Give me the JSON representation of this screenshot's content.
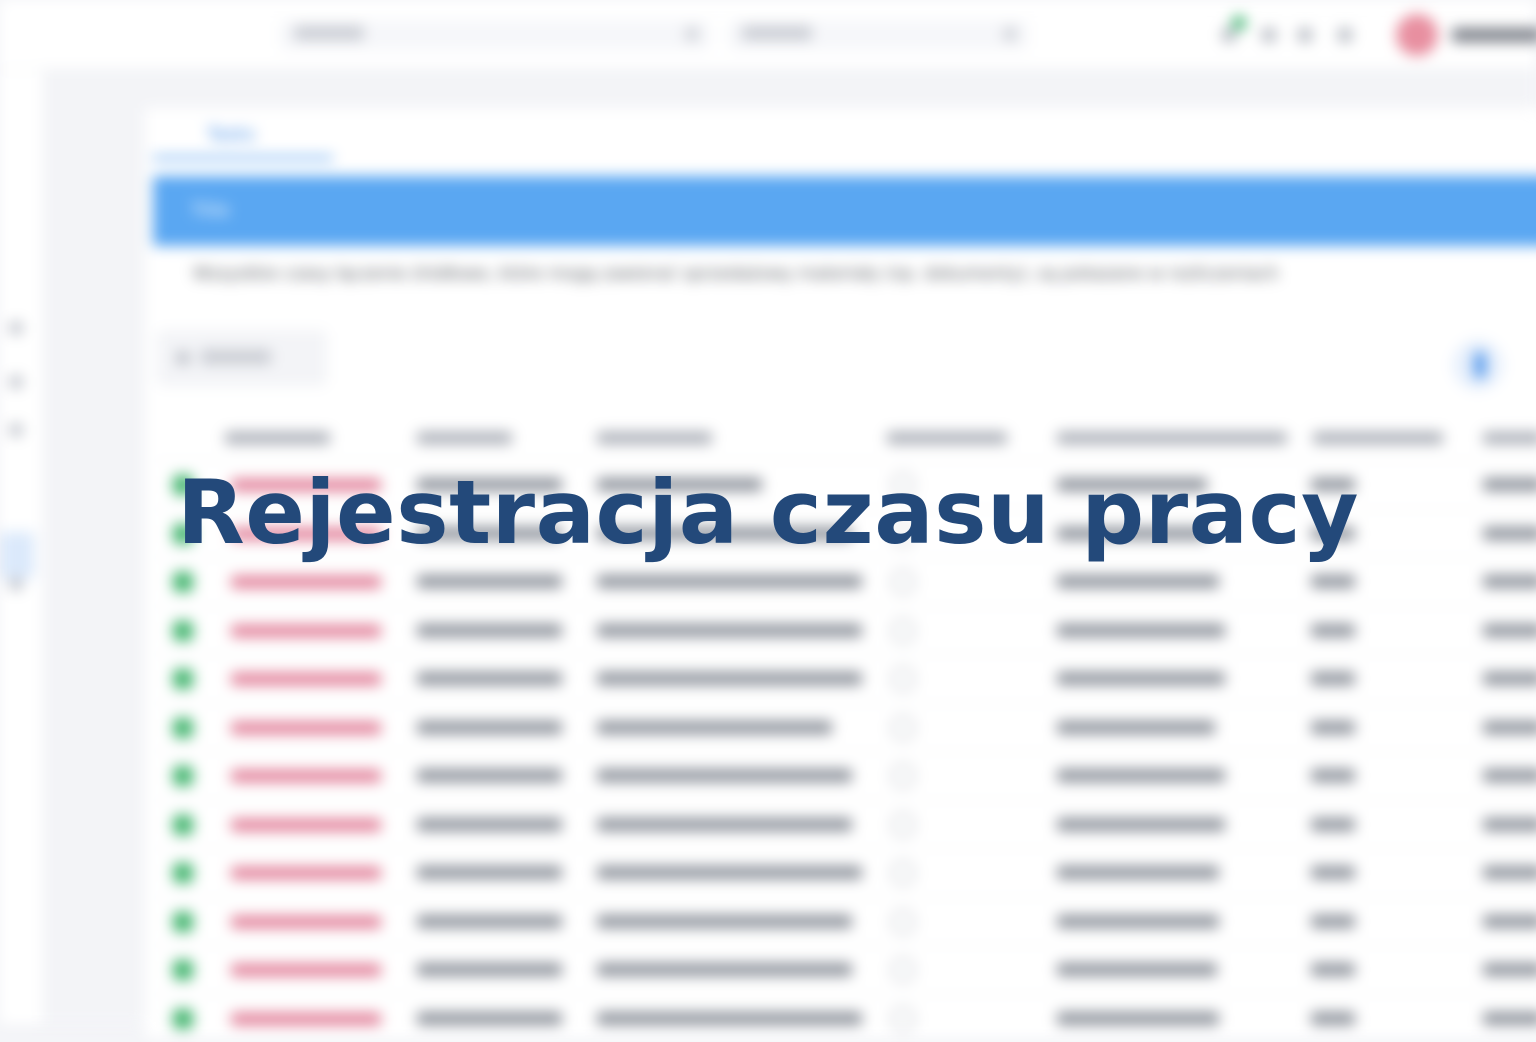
{
  "app": {
    "tab_label": "Tasks",
    "banner_label": "Title",
    "notice": "Wszystkie czasy łączenie źródłowe, które mogą zawierać sprzedażowy materiały (np. dokumenty), są pokazane w rozliczeniach",
    "filter_label": "Filtruj"
  },
  "overlay": {
    "title": "Rejestracja czasu pracy"
  },
  "table": {
    "row_count": 12,
    "status_color": "#3eb36b",
    "name_color": "#e07b95"
  },
  "colors": {
    "accent": "#5aa7f2",
    "title": "#23497a",
    "avatar": "#e88fa0"
  },
  "icons": [
    "search-icon",
    "chevron-down-icon",
    "notification-icon",
    "help-icon",
    "settings-icon",
    "grid-icon",
    "avatar",
    "filter-icon"
  ]
}
